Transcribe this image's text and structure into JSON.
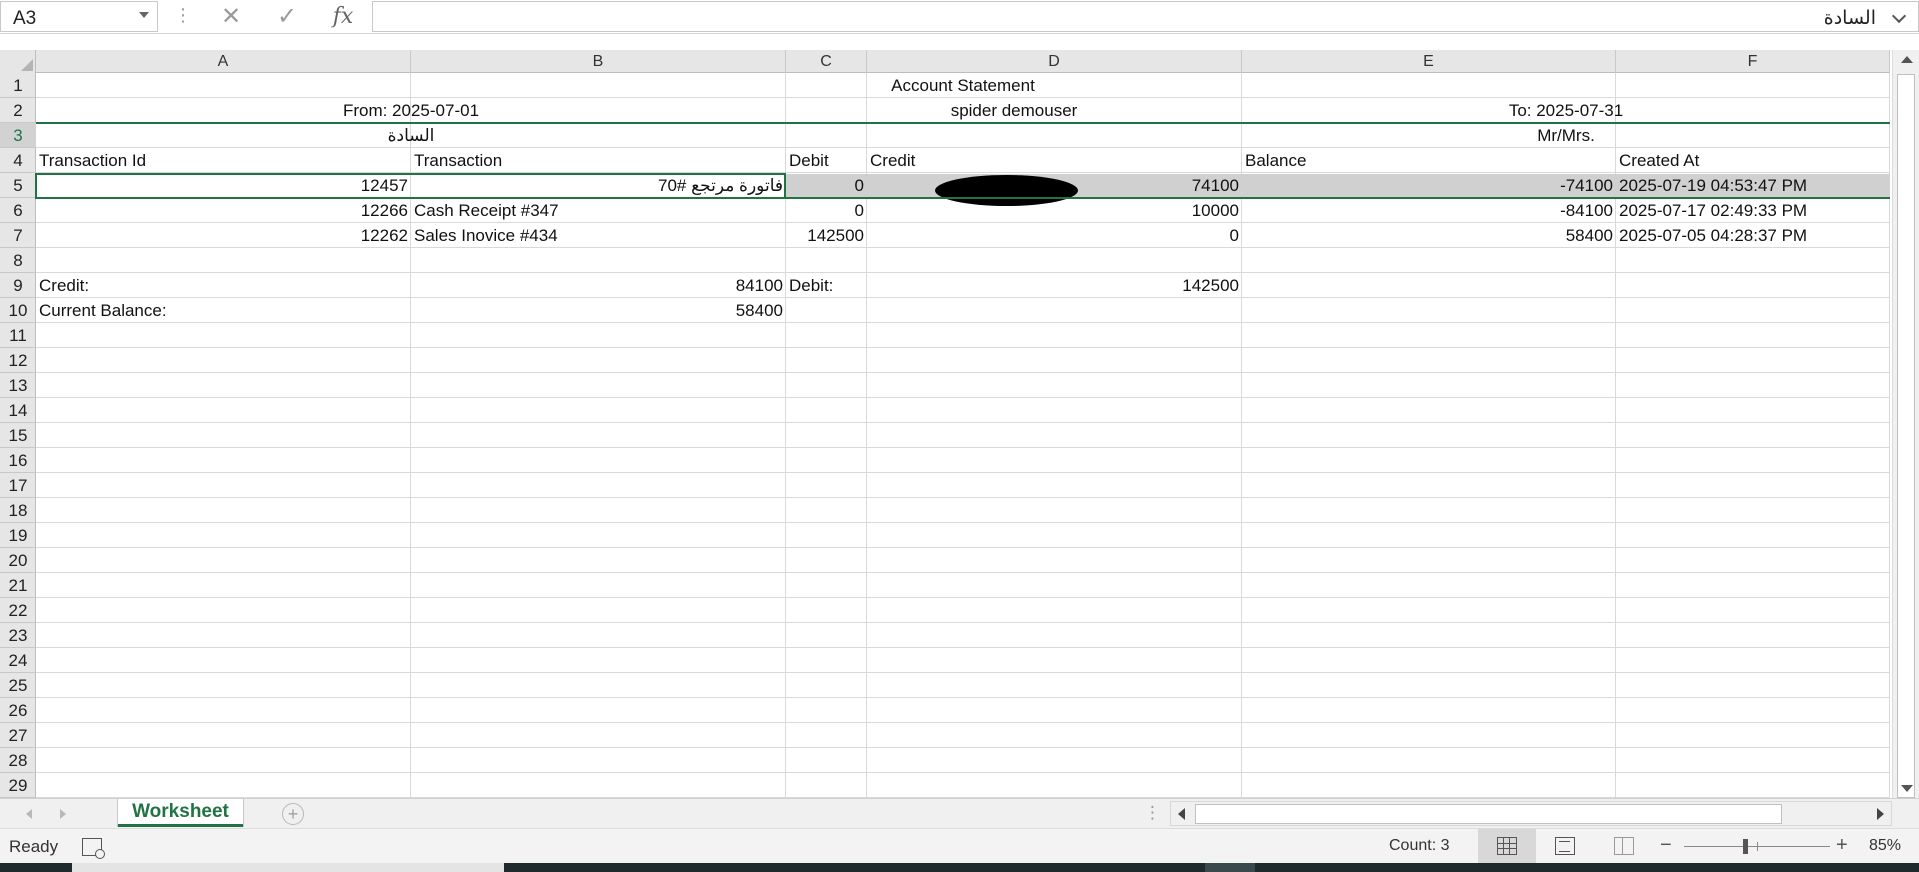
{
  "formula_bar": {
    "namebox": "A3",
    "formula": "السادة"
  },
  "columns": [
    "A",
    "B",
    "C",
    "D",
    "E",
    "F"
  ],
  "rows": [
    "1",
    "2",
    "3",
    "4",
    "5",
    "6",
    "7",
    "8",
    "9",
    "10",
    "11",
    "12",
    "13",
    "14",
    "15",
    "16",
    "17",
    "18",
    "19",
    "20",
    "21",
    "22",
    "23",
    "24",
    "25",
    "26",
    "27",
    "28",
    "29"
  ],
  "sheet": {
    "title": "Account Statement",
    "from": "From: 2025-07-01",
    "customer": "spider demouser",
    "to": "To: 2025-07-31",
    "salutation_ar": "السادة",
    "salutation_en": "Mr/Mrs.",
    "headers": [
      "Transaction Id",
      "Transaction",
      "Debit",
      "Credit",
      "Balance",
      "Created At"
    ],
    "transactions": [
      {
        "id": "12457",
        "transaction": "فاتورة مرتجع #70",
        "debit": "0",
        "credit": "74100",
        "balance": "-74100",
        "created_at": "2025-07-19 04:53:47 PM"
      },
      {
        "id": "12266",
        "transaction": "Cash Receipt #347",
        "debit": "0",
        "credit": "10000",
        "balance": "-84100",
        "created_at": "2025-07-17 02:49:33 PM"
      },
      {
        "id": "12262",
        "transaction": "Sales Inovice #434",
        "debit": "142500",
        "credit": "0",
        "balance": "58400",
        "created_at": "2025-07-05 04:28:37 PM"
      }
    ],
    "summary": {
      "credit_label": "Credit:",
      "credit_value": "84100",
      "debit_label": "Debit:",
      "debit_value": "142500",
      "balance_label": "Current Balance:",
      "balance_value": "58400"
    }
  },
  "tabs": {
    "sheet_name": "Worksheet",
    "add": "+"
  },
  "status": {
    "ready": "Ready",
    "count": "Count: 3",
    "zoom": "85%",
    "zoom_percent": 85
  },
  "icons": {
    "cancel": "cancel-icon",
    "enter": "enter-icon",
    "function": "fx-icon"
  },
  "colors": {
    "accent": "#217346",
    "header_bg": "#e6e6e6",
    "merged_shade": "#d0d0d0"
  }
}
